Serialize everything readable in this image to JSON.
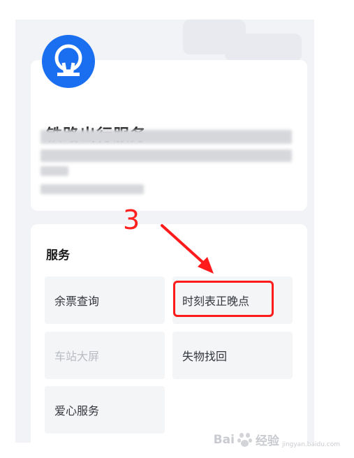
{
  "header": {
    "app_title": "铁路出行服务"
  },
  "services": {
    "section_title": "服务",
    "tiles": [
      {
        "label": "余票查询",
        "enabled": true
      },
      {
        "label": "时刻表正晚点",
        "enabled": true
      },
      {
        "label": "车站大屏",
        "enabled": false
      },
      {
        "label": "失物找回",
        "enabled": true
      },
      {
        "label": "爱心服务",
        "enabled": true
      }
    ]
  },
  "annotation": {
    "step_number": "3"
  },
  "watermark": {
    "brand": "Bai",
    "suffix": "经验",
    "site": "jingyan.baidu.com"
  },
  "colors": {
    "brand_blue": "#1a6ff0",
    "highlight_red": "#ff1b1b"
  },
  "icons": {
    "logo": "railway-logo-icon"
  }
}
